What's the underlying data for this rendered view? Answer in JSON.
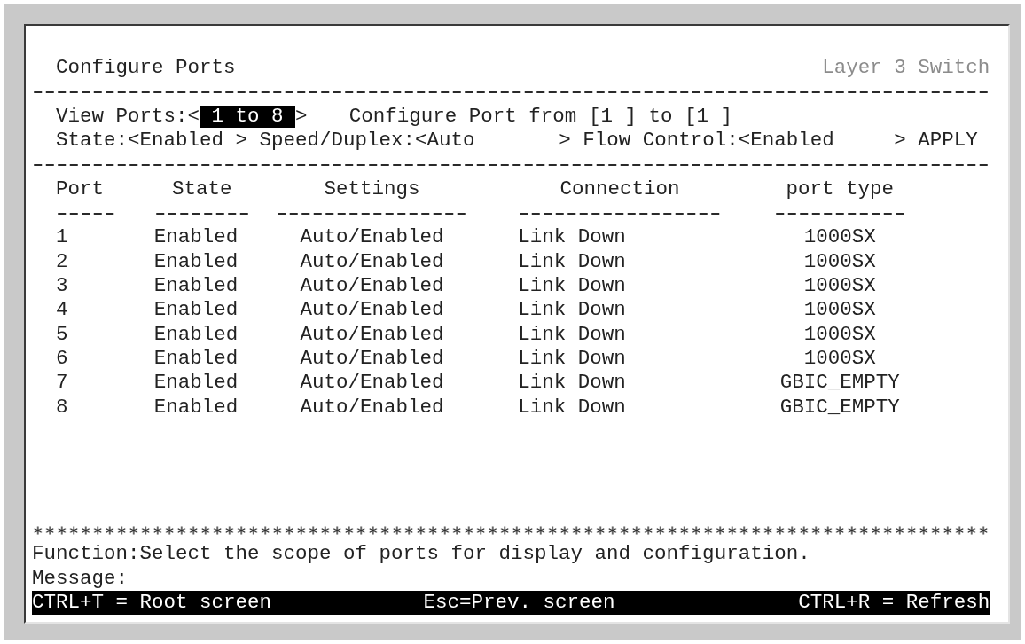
{
  "header": {
    "title": "Configure Ports",
    "device": "Layer 3 Switch"
  },
  "controls": {
    "view_ports": {
      "label": "View Ports:",
      "open": "<",
      "value": "1 to 8",
      "close": ">",
      "selected": true
    },
    "configure_port": {
      "label": "Configure Port from",
      "from": "[1 ]",
      "to_label": "to",
      "to": "[1 ]"
    },
    "settings": [
      {
        "label": "State:",
        "open": "<",
        "value": "Enabled",
        "close": ">",
        "selected": false
      },
      {
        "label": "Speed/Duplex:",
        "open": "<",
        "value": "Auto",
        "close": ">",
        "selected": false
      },
      {
        "label": "Flow Control:",
        "open": "<",
        "value": "Enabled",
        "close": ">",
        "selected": false
      }
    ],
    "apply": "APPLY"
  },
  "table": {
    "columns": [
      "Port",
      "State",
      "Settings",
      "Connection",
      "port type"
    ],
    "rows": [
      {
        "port": "1",
        "state": "Enabled",
        "settings": "Auto/Enabled",
        "connection": "Link Down",
        "port_type": "1000SX"
      },
      {
        "port": "2",
        "state": "Enabled",
        "settings": "Auto/Enabled",
        "connection": "Link Down",
        "port_type": "1000SX"
      },
      {
        "port": "3",
        "state": "Enabled",
        "settings": "Auto/Enabled",
        "connection": "Link Down",
        "port_type": "1000SX"
      },
      {
        "port": "4",
        "state": "Enabled",
        "settings": "Auto/Enabled",
        "connection": "Link Down",
        "port_type": "1000SX"
      },
      {
        "port": "5",
        "state": "Enabled",
        "settings": "Auto/Enabled",
        "connection": "Link Down",
        "port_type": "1000SX"
      },
      {
        "port": "6",
        "state": "Enabled",
        "settings": "Auto/Enabled",
        "connection": "Link Down",
        "port_type": "1000SX"
      },
      {
        "port": "7",
        "state": "Enabled",
        "settings": "Auto/Enabled",
        "connection": "Link Down",
        "port_type": "GBIC_EMPTY"
      },
      {
        "port": "8",
        "state": "Enabled",
        "settings": "Auto/Enabled",
        "connection": "Link Down",
        "port_type": "GBIC_EMPTY"
      }
    ]
  },
  "function_text": "Function:Select the scope of ports for display and configuration.",
  "message_label": "Message:",
  "shortcuts": [
    "CTRL+T = Root screen",
    "Esc=Prev. screen",
    "CTRL+R = Refresh"
  ]
}
